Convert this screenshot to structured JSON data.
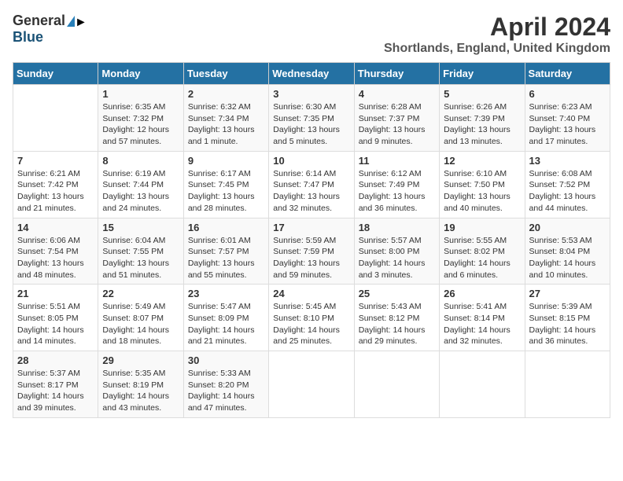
{
  "header": {
    "logo_general": "General",
    "logo_blue": "Blue",
    "title": "April 2024",
    "subtitle": "Shortlands, England, United Kingdom"
  },
  "weekdays": [
    "Sunday",
    "Monday",
    "Tuesday",
    "Wednesday",
    "Thursday",
    "Friday",
    "Saturday"
  ],
  "weeks": [
    [
      {
        "day": "",
        "info": ""
      },
      {
        "day": "1",
        "info": "Sunrise: 6:35 AM\nSunset: 7:32 PM\nDaylight: 12 hours\nand 57 minutes."
      },
      {
        "day": "2",
        "info": "Sunrise: 6:32 AM\nSunset: 7:34 PM\nDaylight: 13 hours\nand 1 minute."
      },
      {
        "day": "3",
        "info": "Sunrise: 6:30 AM\nSunset: 7:35 PM\nDaylight: 13 hours\nand 5 minutes."
      },
      {
        "day": "4",
        "info": "Sunrise: 6:28 AM\nSunset: 7:37 PM\nDaylight: 13 hours\nand 9 minutes."
      },
      {
        "day": "5",
        "info": "Sunrise: 6:26 AM\nSunset: 7:39 PM\nDaylight: 13 hours\nand 13 minutes."
      },
      {
        "day": "6",
        "info": "Sunrise: 6:23 AM\nSunset: 7:40 PM\nDaylight: 13 hours\nand 17 minutes."
      }
    ],
    [
      {
        "day": "7",
        "info": "Sunrise: 6:21 AM\nSunset: 7:42 PM\nDaylight: 13 hours\nand 21 minutes."
      },
      {
        "day": "8",
        "info": "Sunrise: 6:19 AM\nSunset: 7:44 PM\nDaylight: 13 hours\nand 24 minutes."
      },
      {
        "day": "9",
        "info": "Sunrise: 6:17 AM\nSunset: 7:45 PM\nDaylight: 13 hours\nand 28 minutes."
      },
      {
        "day": "10",
        "info": "Sunrise: 6:14 AM\nSunset: 7:47 PM\nDaylight: 13 hours\nand 32 minutes."
      },
      {
        "day": "11",
        "info": "Sunrise: 6:12 AM\nSunset: 7:49 PM\nDaylight: 13 hours\nand 36 minutes."
      },
      {
        "day": "12",
        "info": "Sunrise: 6:10 AM\nSunset: 7:50 PM\nDaylight: 13 hours\nand 40 minutes."
      },
      {
        "day": "13",
        "info": "Sunrise: 6:08 AM\nSunset: 7:52 PM\nDaylight: 13 hours\nand 44 minutes."
      }
    ],
    [
      {
        "day": "14",
        "info": "Sunrise: 6:06 AM\nSunset: 7:54 PM\nDaylight: 13 hours\nand 48 minutes."
      },
      {
        "day": "15",
        "info": "Sunrise: 6:04 AM\nSunset: 7:55 PM\nDaylight: 13 hours\nand 51 minutes."
      },
      {
        "day": "16",
        "info": "Sunrise: 6:01 AM\nSunset: 7:57 PM\nDaylight: 13 hours\nand 55 minutes."
      },
      {
        "day": "17",
        "info": "Sunrise: 5:59 AM\nSunset: 7:59 PM\nDaylight: 13 hours\nand 59 minutes."
      },
      {
        "day": "18",
        "info": "Sunrise: 5:57 AM\nSunset: 8:00 PM\nDaylight: 14 hours\nand 3 minutes."
      },
      {
        "day": "19",
        "info": "Sunrise: 5:55 AM\nSunset: 8:02 PM\nDaylight: 14 hours\nand 6 minutes."
      },
      {
        "day": "20",
        "info": "Sunrise: 5:53 AM\nSunset: 8:04 PM\nDaylight: 14 hours\nand 10 minutes."
      }
    ],
    [
      {
        "day": "21",
        "info": "Sunrise: 5:51 AM\nSunset: 8:05 PM\nDaylight: 14 hours\nand 14 minutes."
      },
      {
        "day": "22",
        "info": "Sunrise: 5:49 AM\nSunset: 8:07 PM\nDaylight: 14 hours\nand 18 minutes."
      },
      {
        "day": "23",
        "info": "Sunrise: 5:47 AM\nSunset: 8:09 PM\nDaylight: 14 hours\nand 21 minutes."
      },
      {
        "day": "24",
        "info": "Sunrise: 5:45 AM\nSunset: 8:10 PM\nDaylight: 14 hours\nand 25 minutes."
      },
      {
        "day": "25",
        "info": "Sunrise: 5:43 AM\nSunset: 8:12 PM\nDaylight: 14 hours\nand 29 minutes."
      },
      {
        "day": "26",
        "info": "Sunrise: 5:41 AM\nSunset: 8:14 PM\nDaylight: 14 hours\nand 32 minutes."
      },
      {
        "day": "27",
        "info": "Sunrise: 5:39 AM\nSunset: 8:15 PM\nDaylight: 14 hours\nand 36 minutes."
      }
    ],
    [
      {
        "day": "28",
        "info": "Sunrise: 5:37 AM\nSunset: 8:17 PM\nDaylight: 14 hours\nand 39 minutes."
      },
      {
        "day": "29",
        "info": "Sunrise: 5:35 AM\nSunset: 8:19 PM\nDaylight: 14 hours\nand 43 minutes."
      },
      {
        "day": "30",
        "info": "Sunrise: 5:33 AM\nSunset: 8:20 PM\nDaylight: 14 hours\nand 47 minutes."
      },
      {
        "day": "",
        "info": ""
      },
      {
        "day": "",
        "info": ""
      },
      {
        "day": "",
        "info": ""
      },
      {
        "day": "",
        "info": ""
      }
    ]
  ]
}
